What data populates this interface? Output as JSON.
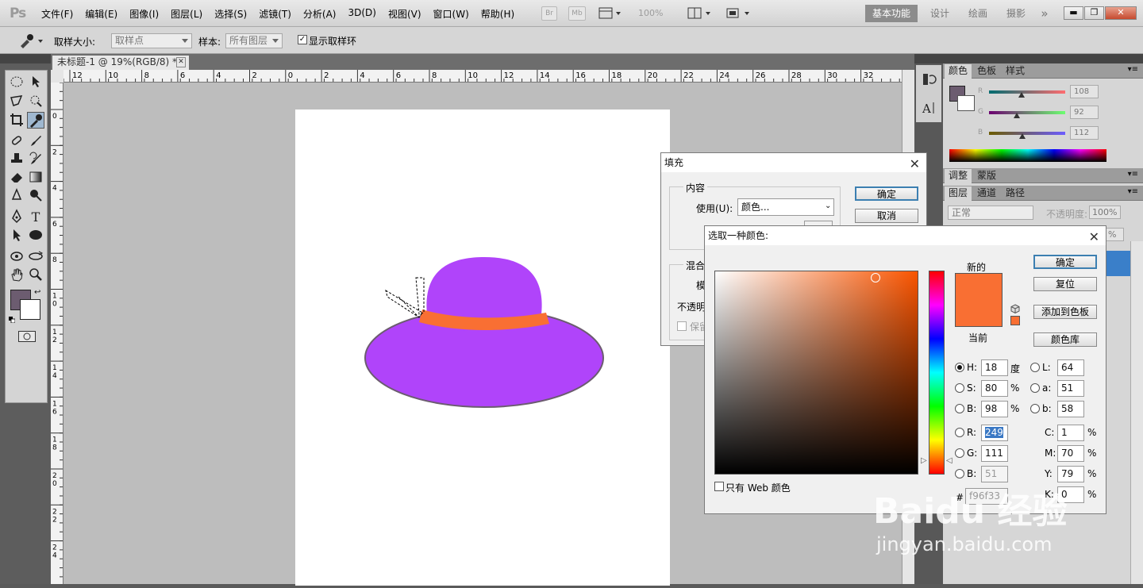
{
  "app": {
    "logo": "Ps"
  },
  "menu": [
    "文件(F)",
    "编辑(E)",
    "图像(I)",
    "图层(L)",
    "选择(S)",
    "滤镜(T)",
    "分析(A)",
    "3D(D)",
    "视图(V)",
    "窗口(W)",
    "帮助(H)"
  ],
  "topbar": {
    "br": "Br",
    "mb": "Mb",
    "zoom": "100%"
  },
  "workspaces": [
    "基本功能",
    "设计",
    "绘画",
    "摄影",
    "»"
  ],
  "options": {
    "sample_size_label": "取样大小:",
    "sample_size_value": "取样点",
    "sample_label": "样本:",
    "sample_value": "所有图层",
    "show_ring_label": "显示取样环"
  },
  "document": {
    "tab_title": "未标题-1 @ 19%(RGB/8) *",
    "close": "✕"
  },
  "ruler": {
    "h_labels": [
      "12",
      "10",
      "8",
      "6",
      "4",
      "2",
      "0",
      "2",
      "4",
      "6",
      "8",
      "10",
      "12",
      "14",
      "16",
      "18",
      "20",
      "22",
      "24",
      "26",
      "28",
      "30",
      "32"
    ],
    "v_labels": [
      "0",
      "2",
      "4",
      "6",
      "8",
      "1\n0",
      "1\n2",
      "1\n4",
      "1\n6",
      "1\n8",
      "2\n0",
      "2\n2",
      "2\n4"
    ]
  },
  "colors": {
    "hat_body": "#b044fa",
    "hat_band": "#f96f33",
    "foreground": "#6c5c70",
    "new_color": "#f96f33"
  },
  "color_panel": {
    "tabs": [
      "颜色",
      "色板",
      "样式"
    ],
    "channels": [
      {
        "label": "R",
        "value": "108"
      },
      {
        "label": "G",
        "value": "92"
      },
      {
        "label": "B",
        "value": "112"
      }
    ]
  },
  "adjust_panel": {
    "tabs": [
      "调整",
      "蒙版"
    ]
  },
  "layers_panel": {
    "tabs": [
      "图层",
      "通道",
      "路径"
    ],
    "blend_mode": "正常",
    "opacity_label": "不透明度:",
    "opacity_value": "100%",
    "fill_value": "%"
  },
  "fill_dialog": {
    "title": "填充",
    "group_content": "内容",
    "use_label": "使用(U):",
    "use_value": "颜色...",
    "ok": "确定",
    "cancel": "取消",
    "group_blend": "混合",
    "mode_label": "模",
    "opacity_label": "不透明",
    "preserve_label": "保留"
  },
  "color_picker": {
    "title": "选取一种颜色:",
    "new_label": "新的",
    "current_label": "当前",
    "ok": "确定",
    "reset": "复位",
    "add_swatch": "添加到色板",
    "color_library": "颜色库",
    "web_only": "只有 Web 颜色",
    "hash": "#",
    "hex": "f96f33",
    "fields": {
      "H": "18",
      "S": "80",
      "Bv": "98",
      "R": "249",
      "G": "111",
      "B": "51",
      "L": "64",
      "a": "51",
      "b": "58",
      "C": "1",
      "M": "70",
      "Y": "79",
      "K": "0"
    },
    "units": {
      "deg": "度",
      "pct": "%"
    }
  },
  "watermark": {
    "line1": "Baidu 经验",
    "line2": "jingyan.baidu.com"
  }
}
